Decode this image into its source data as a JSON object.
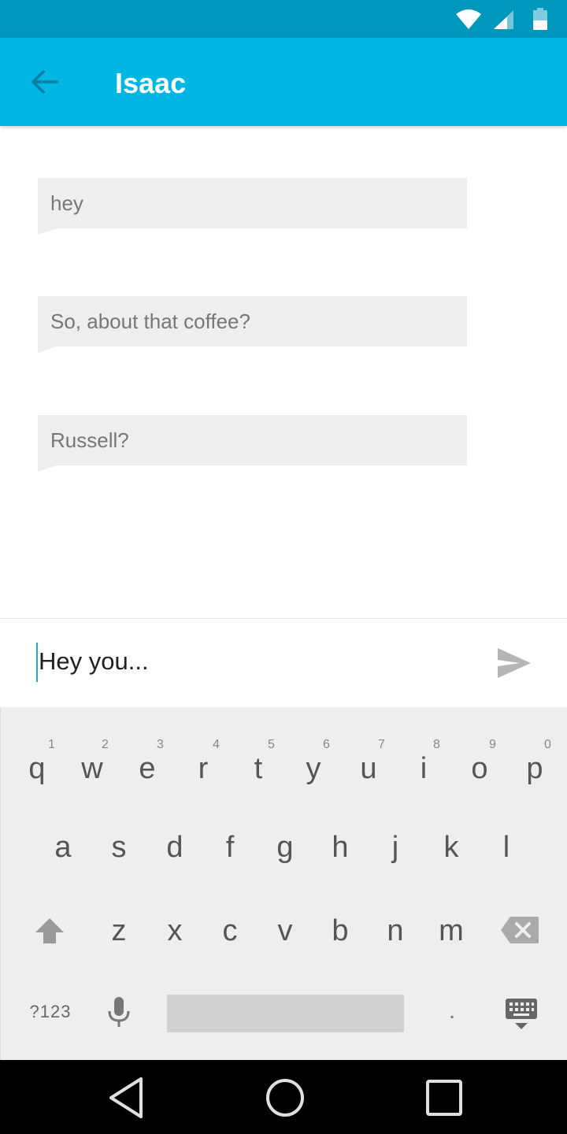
{
  "status_bar": {
    "icons": [
      "wifi-icon",
      "cell-signal-icon",
      "battery-icon"
    ]
  },
  "app_bar": {
    "title": "Isaac",
    "back_icon": "arrow-back-icon",
    "color": "#00b6e3"
  },
  "messages": [
    {
      "text": "hey"
    },
    {
      "text": "So, about that coffee?"
    },
    {
      "text": "Russell?"
    }
  ],
  "compose": {
    "value": "Hey you...",
    "send_icon": "send-icon"
  },
  "keyboard": {
    "row1": [
      {
        "key": "q",
        "hint": "1"
      },
      {
        "key": "w",
        "hint": "2"
      },
      {
        "key": "e",
        "hint": "3"
      },
      {
        "key": "r",
        "hint": "4"
      },
      {
        "key": "t",
        "hint": "5"
      },
      {
        "key": "y",
        "hint": "6"
      },
      {
        "key": "u",
        "hint": "7"
      },
      {
        "key": "i",
        "hint": "8"
      },
      {
        "key": "o",
        "hint": "9"
      },
      {
        "key": "p",
        "hint": "0"
      }
    ],
    "row2": [
      "a",
      "s",
      "d",
      "f",
      "g",
      "h",
      "j",
      "k",
      "l"
    ],
    "row3": [
      "z",
      "x",
      "c",
      "v",
      "b",
      "n",
      "m"
    ],
    "symbols_label": "?123",
    "period_label": ".",
    "icons": [
      "shift-icon",
      "backspace-icon",
      "microphone-icon",
      "keyboard-hide-icon"
    ]
  },
  "nav_bar": {
    "icons": [
      "nav-back-icon",
      "nav-home-icon",
      "nav-recents-icon"
    ]
  }
}
